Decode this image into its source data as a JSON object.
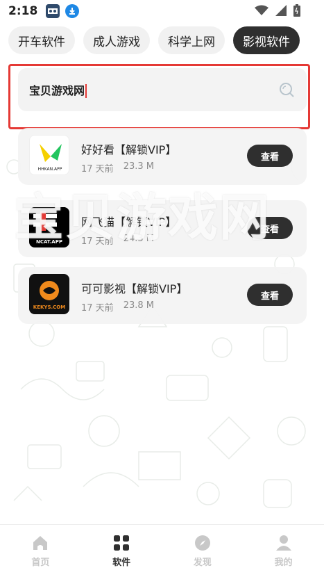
{
  "status_bar": {
    "time": "2:18",
    "icons": [
      "app-notification-icon",
      "download-icon"
    ],
    "system_icons": [
      "wifi-icon",
      "signal-icon",
      "battery-icon"
    ]
  },
  "tabs": [
    {
      "label": "开车软件",
      "active": false
    },
    {
      "label": "成人游戏",
      "active": false
    },
    {
      "label": "科学上网",
      "active": false
    },
    {
      "label": "影视软件",
      "active": true
    }
  ],
  "search": {
    "value": "宝贝游戏网",
    "icon": "search-icon"
  },
  "apps": [
    {
      "name": "好好看【解锁VIP】",
      "time": "17 天前",
      "size": "23.3 M",
      "button": "查看",
      "logo_text": "HHKAN.APP"
    },
    {
      "name": "网飞猫【解锁VIP】",
      "time": "17 天前",
      "size": "24.3 M",
      "button": "查看",
      "logo_text": "NCAT.APP"
    },
    {
      "name": "可可影视【解锁VIP】",
      "time": "17 天前",
      "size": "23.8 M",
      "button": "查看",
      "logo_text": "KEKYS.COM"
    }
  ],
  "watermark": "宝贝游戏网",
  "bottom_nav": [
    {
      "label": "首页",
      "icon": "home-icon",
      "active": false
    },
    {
      "label": "软件",
      "icon": "apps-grid-icon",
      "active": true
    },
    {
      "label": "发现",
      "icon": "compass-icon",
      "active": false
    },
    {
      "label": "我的",
      "icon": "profile-icon",
      "active": false
    }
  ],
  "colors": {
    "accent_dark": "#2f2f2f",
    "highlight": "#e53935",
    "card_bg": "#f3f3f3"
  }
}
